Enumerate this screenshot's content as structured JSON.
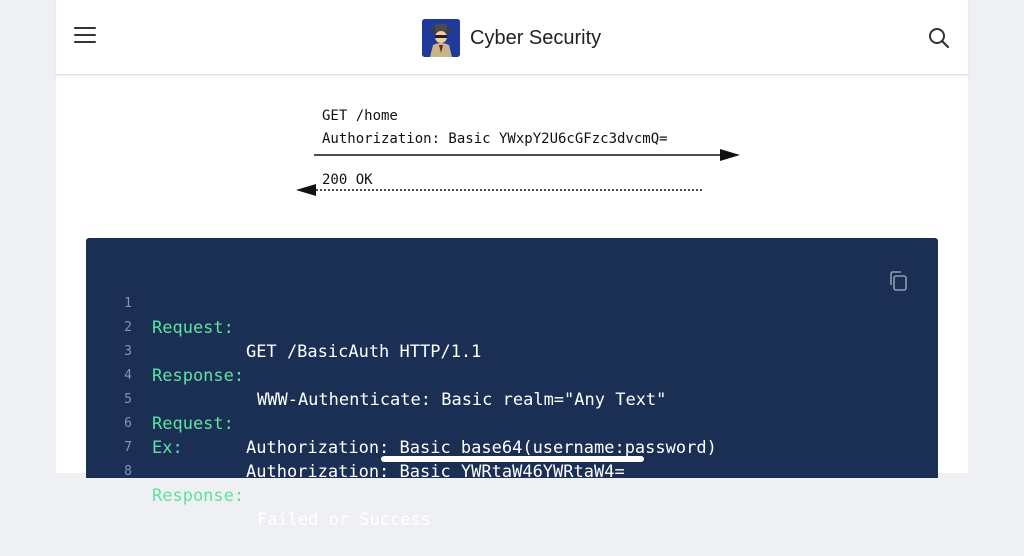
{
  "header": {
    "title": "Cyber Security",
    "menu_icon": "hamburger-menu-icon",
    "search_icon": "search-icon",
    "logo_icon": "spy-detective-icon"
  },
  "diagram": {
    "request_line": "GET /home",
    "auth_line": "Authorization: Basic YWxpY2U6cGFzc3dvcmQ=",
    "response_line": "200 OK"
  },
  "code_block": {
    "copy_icon": "copy-icon",
    "background": "#1b2f54",
    "keyword_color": "#5ee2a0",
    "lines": [
      {
        "num": "1",
        "keyword": "Request:",
        "value": "GET /BasicAuth HTTP/1.1"
      },
      {
        "num": "2",
        "keyword": "",
        "value": ""
      },
      {
        "num": "3",
        "keyword": "Response:",
        "value": "WWW-Authenticate: Basic realm=\"Any Text\""
      },
      {
        "num": "4",
        "keyword": "",
        "value": ""
      },
      {
        "num": "5",
        "keyword": "Request:",
        "value": "Authorization: Basic base64(username:password)"
      },
      {
        "num": "6",
        "keyword": "Ex:",
        "value": "Authorization: Basic YWRtaW46YWRtaW4="
      },
      {
        "num": "7",
        "keyword": "",
        "value": ""
      },
      {
        "num": "8",
        "keyword": "Response:",
        "value": "Failed or Success"
      }
    ]
  }
}
